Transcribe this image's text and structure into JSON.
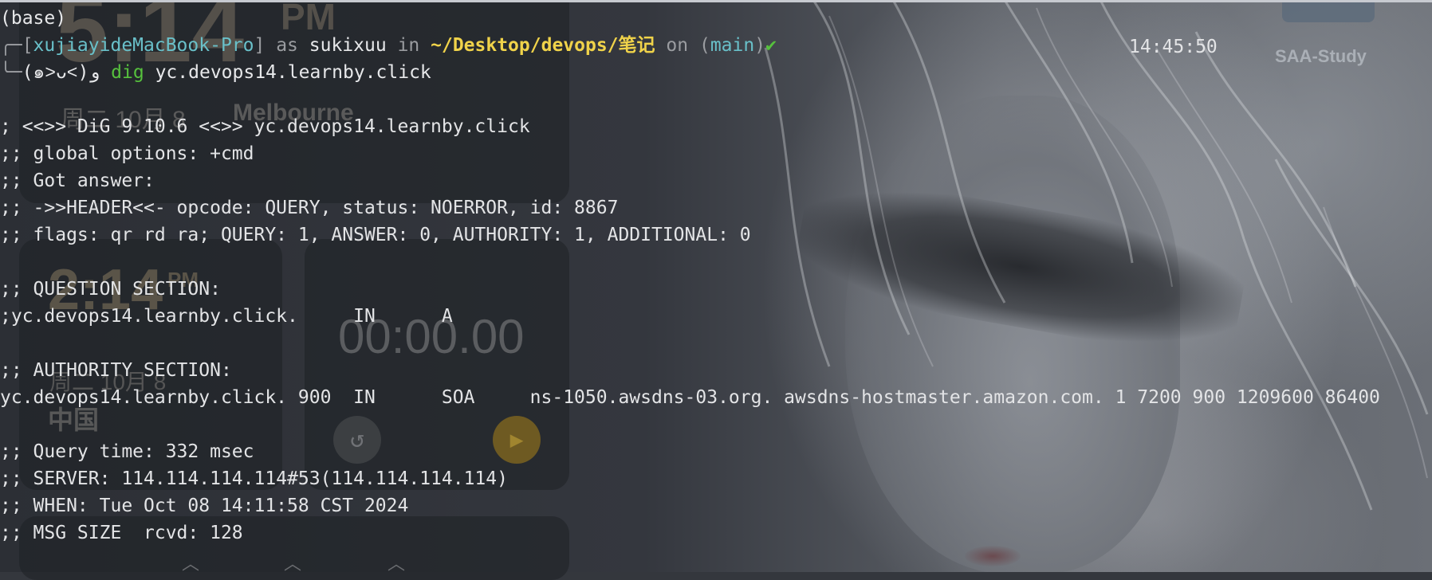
{
  "wallpaper_widgets": {
    "clock_time": "5:14",
    "clock_ampm": "PM",
    "clock_date": "周二  10月 8",
    "clock_city": "Melbourne",
    "clock2_time": "2:14",
    "clock2_ampm": "PM",
    "clock2_date": "周二  10月 8",
    "clock2_place": "中国",
    "timer_value": "00:00.00",
    "saa_label": "SAA-Study"
  },
  "prompt": {
    "base": "(base)",
    "host": "xujiayideMacBook-Pro",
    "as_word": "as",
    "user": "sukixuu",
    "in_word": "in",
    "path": "~/Desktop/devops/笔记",
    "on_word": "on",
    "branch": "main",
    "check": "✔",
    "time": "14:45:50",
    "kaomoji": "(๑˃ᴗ˂)ﻭ",
    "command": "dig",
    "argument": "yc.devops14.learnby.click"
  },
  "output": [
    "; <<>> DiG 9.10.6 <<>> yc.devops14.learnby.click",
    ";; global options: +cmd",
    ";; Got answer:",
    ";; ->>HEADER<<- opcode: QUERY, status: NOERROR, id: 8867",
    ";; flags: qr rd ra; QUERY: 1, ANSWER: 0, AUTHORITY: 1, ADDITIONAL: 0",
    "",
    ";; QUESTION SECTION:",
    ";yc.devops14.learnby.click.     IN      A",
    "",
    ";; AUTHORITY SECTION:",
    "yc.devops14.learnby.click. 900  IN      SOA     ns-1050.awsdns-03.org. awsdns-hostmaster.amazon.com. 1 7200 900 1209600 86400",
    "",
    ";; Query time: 332 msec",
    ";; SERVER: 114.114.114.114#53(114.114.114.114)",
    ";; WHEN: Tue Oct 08 14:11:58 CST 2024",
    ";; MSG SIZE  rcvd: 128"
  ],
  "colors": {
    "prompt_host": "#69c0c9",
    "prompt_path": "#f0d34a",
    "prompt_check": "#56c13d",
    "command": "#56c13d",
    "text": "#e3e4e6"
  }
}
